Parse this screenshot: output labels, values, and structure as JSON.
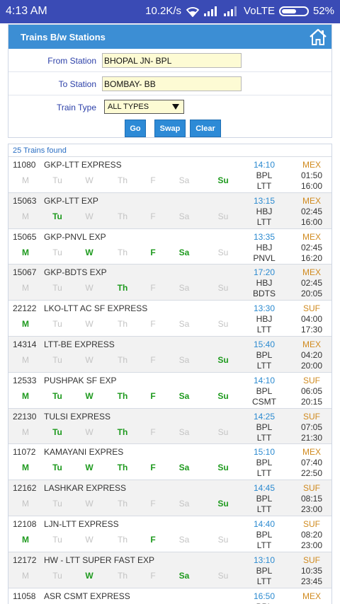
{
  "status_bar": {
    "time": "4:13 AM",
    "speed": "10.2K/s",
    "network": "VoLTE",
    "battery": "52%"
  },
  "form": {
    "title": "Trains B/w Stations",
    "from_label": "From Station",
    "from_value": "BHOPAL  JN- BPL",
    "to_label": "To Station",
    "to_value": "BOMBAY- BB",
    "type_label": "Train Type",
    "type_value": "ALL TYPES",
    "buttons": {
      "go": "Go",
      "swap": "Swap",
      "clear": "Clear"
    }
  },
  "results": {
    "count_text": "25 Trains found",
    "day_labels": [
      "M",
      "Tu",
      "W",
      "Th",
      "F",
      "Sa",
      "Su"
    ],
    "trains": [
      {
        "number": "11080",
        "name": "GKP-LTT EXPRESS",
        "dep": "14:10",
        "type": "MEX",
        "from": "BPL",
        "to": "LTT",
        "time1": "01:50",
        "time2": "16:00",
        "days": [
          false,
          false,
          false,
          false,
          false,
          false,
          true
        ]
      },
      {
        "number": "15063",
        "name": "GKP-LTT EXP",
        "dep": "13:15",
        "type": "MEX",
        "from": "HBJ",
        "to": "LTT",
        "time1": "02:45",
        "time2": "16:00",
        "days": [
          false,
          true,
          false,
          false,
          false,
          false,
          false
        ]
      },
      {
        "number": "15065",
        "name": "GKP-PNVL EXP",
        "dep": "13:35",
        "type": "MEX",
        "from": "HBJ",
        "to": "PNVL",
        "time1": "02:45",
        "time2": "16:20",
        "days": [
          true,
          false,
          true,
          false,
          true,
          true,
          false
        ]
      },
      {
        "number": "15067",
        "name": "GKP-BDTS EXP",
        "dep": "17:20",
        "type": "MEX",
        "from": "HBJ",
        "to": "BDTS",
        "time1": "02:45",
        "time2": "20:05",
        "days": [
          false,
          false,
          false,
          true,
          false,
          false,
          false
        ]
      },
      {
        "number": "22122",
        "name": "LKO-LTT AC SF EXPRESS",
        "dep": "13:30",
        "type": "SUF",
        "from": "HBJ",
        "to": "LTT",
        "time1": "04:00",
        "time2": "17:30",
        "days": [
          true,
          false,
          false,
          false,
          false,
          false,
          false
        ]
      },
      {
        "number": "14314",
        "name": "LTT-BE EXPRESS",
        "dep": "15:40",
        "type": "MEX",
        "from": "BPL",
        "to": "LTT",
        "time1": "04:20",
        "time2": "20:00",
        "days": [
          false,
          false,
          false,
          false,
          false,
          false,
          true
        ]
      },
      {
        "number": "12533",
        "name": "PUSHPAK SF EXP",
        "dep": "14:10",
        "type": "SUF",
        "from": "BPL",
        "to": "CSMT",
        "time1": "06:05",
        "time2": "20:15",
        "days": [
          true,
          true,
          true,
          true,
          true,
          true,
          true
        ]
      },
      {
        "number": "22130",
        "name": "TULSI EXPRESS",
        "dep": "14:25",
        "type": "SUF",
        "from": "BPL",
        "to": "LTT",
        "time1": "07:05",
        "time2": "21:30",
        "days": [
          false,
          true,
          false,
          true,
          false,
          false,
          false
        ]
      },
      {
        "number": "11072",
        "name": "KAMAYANI EXPRES",
        "dep": "15:10",
        "type": "MEX",
        "from": "BPL",
        "to": "LTT",
        "time1": "07:40",
        "time2": "22:50",
        "days": [
          true,
          true,
          true,
          true,
          true,
          true,
          true
        ]
      },
      {
        "number": "12162",
        "name": "LASHKAR EXPRESS",
        "dep": "14:45",
        "type": "SUF",
        "from": "BPL",
        "to": "LTT",
        "time1": "08:15",
        "time2": "23:00",
        "days": [
          false,
          false,
          false,
          false,
          false,
          false,
          true
        ]
      },
      {
        "number": "12108",
        "name": "LJN-LTT EXPRESS",
        "dep": "14:40",
        "type": "SUF",
        "from": "BPL",
        "to": "LTT",
        "time1": "08:20",
        "time2": "23:00",
        "days": [
          true,
          false,
          false,
          false,
          true,
          false,
          false
        ]
      },
      {
        "number": "12172",
        "name": "HW - LTT SUPER FAST EXP",
        "dep": "13:10",
        "type": "SUF",
        "from": "BPL",
        "to": "LTT",
        "time1": "10:35",
        "time2": "23:45",
        "days": [
          false,
          false,
          true,
          false,
          false,
          true,
          false
        ]
      },
      {
        "number": "11058",
        "name": "ASR CSMT EXPRESS",
        "dep": "16:50",
        "type": "MEX",
        "from": "BPL",
        "to": "",
        "time1": "",
        "time2": "",
        "days": [
          false,
          false,
          false,
          false,
          false,
          false,
          false
        ]
      }
    ]
  }
}
